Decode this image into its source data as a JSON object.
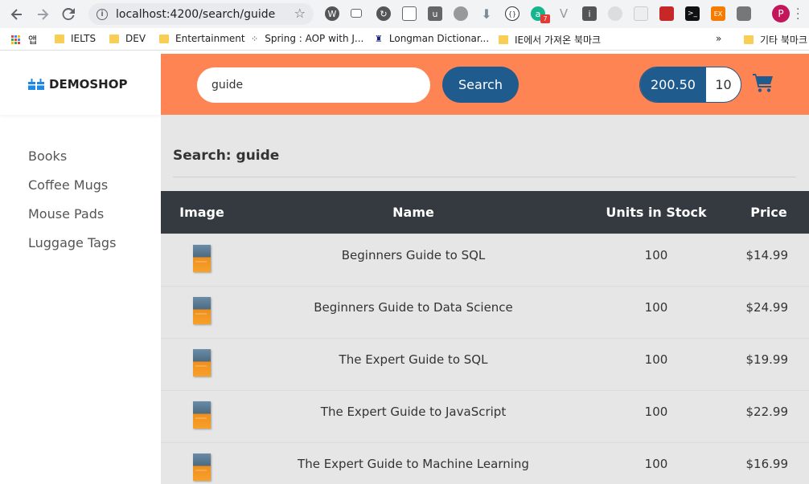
{
  "browser": {
    "url": "localhost:4200/search/guide",
    "extension_badge": "7",
    "profile_initial": "P",
    "bookmarks": [
      {
        "label": "앱"
      },
      {
        "label": "IELTS"
      },
      {
        "label": "DEV"
      },
      {
        "label": "Entertainment"
      },
      {
        "label": "Spring : AOP with J..."
      },
      {
        "label": "Longman Dictionar..."
      },
      {
        "label": "IE에서 가져온 북마크"
      },
      {
        "label": "기타 북마크"
      }
    ],
    "overflow": "»"
  },
  "sidebar": {
    "brand": "DEMOSHOP",
    "items": [
      {
        "label": "Books"
      },
      {
        "label": "Coffee Mugs"
      },
      {
        "label": "Mouse Pads"
      },
      {
        "label": "Luggage Tags"
      }
    ]
  },
  "header": {
    "search_value": "guide",
    "search_button": "Search",
    "cart_total": "200.50",
    "cart_quantity": "10"
  },
  "results": {
    "title": "Search: guide",
    "columns": [
      "Image",
      "Name",
      "Units in Stock",
      "Price"
    ],
    "rows": [
      {
        "name": "Beginners Guide to SQL",
        "stock": "100",
        "price": "$14.99"
      },
      {
        "name": "Beginners Guide to Data Science",
        "stock": "100",
        "price": "$24.99"
      },
      {
        "name": "The Expert Guide to SQL",
        "stock": "100",
        "price": "$19.99"
      },
      {
        "name": "The Expert Guide to JavaScript",
        "stock": "100",
        "price": "$22.99"
      },
      {
        "name": "The Expert Guide to Machine Learning",
        "stock": "100",
        "price": "$16.99"
      }
    ]
  },
  "colors": {
    "header": "#ff8453",
    "primary": "#205b8e",
    "table_header": "#343a40"
  }
}
